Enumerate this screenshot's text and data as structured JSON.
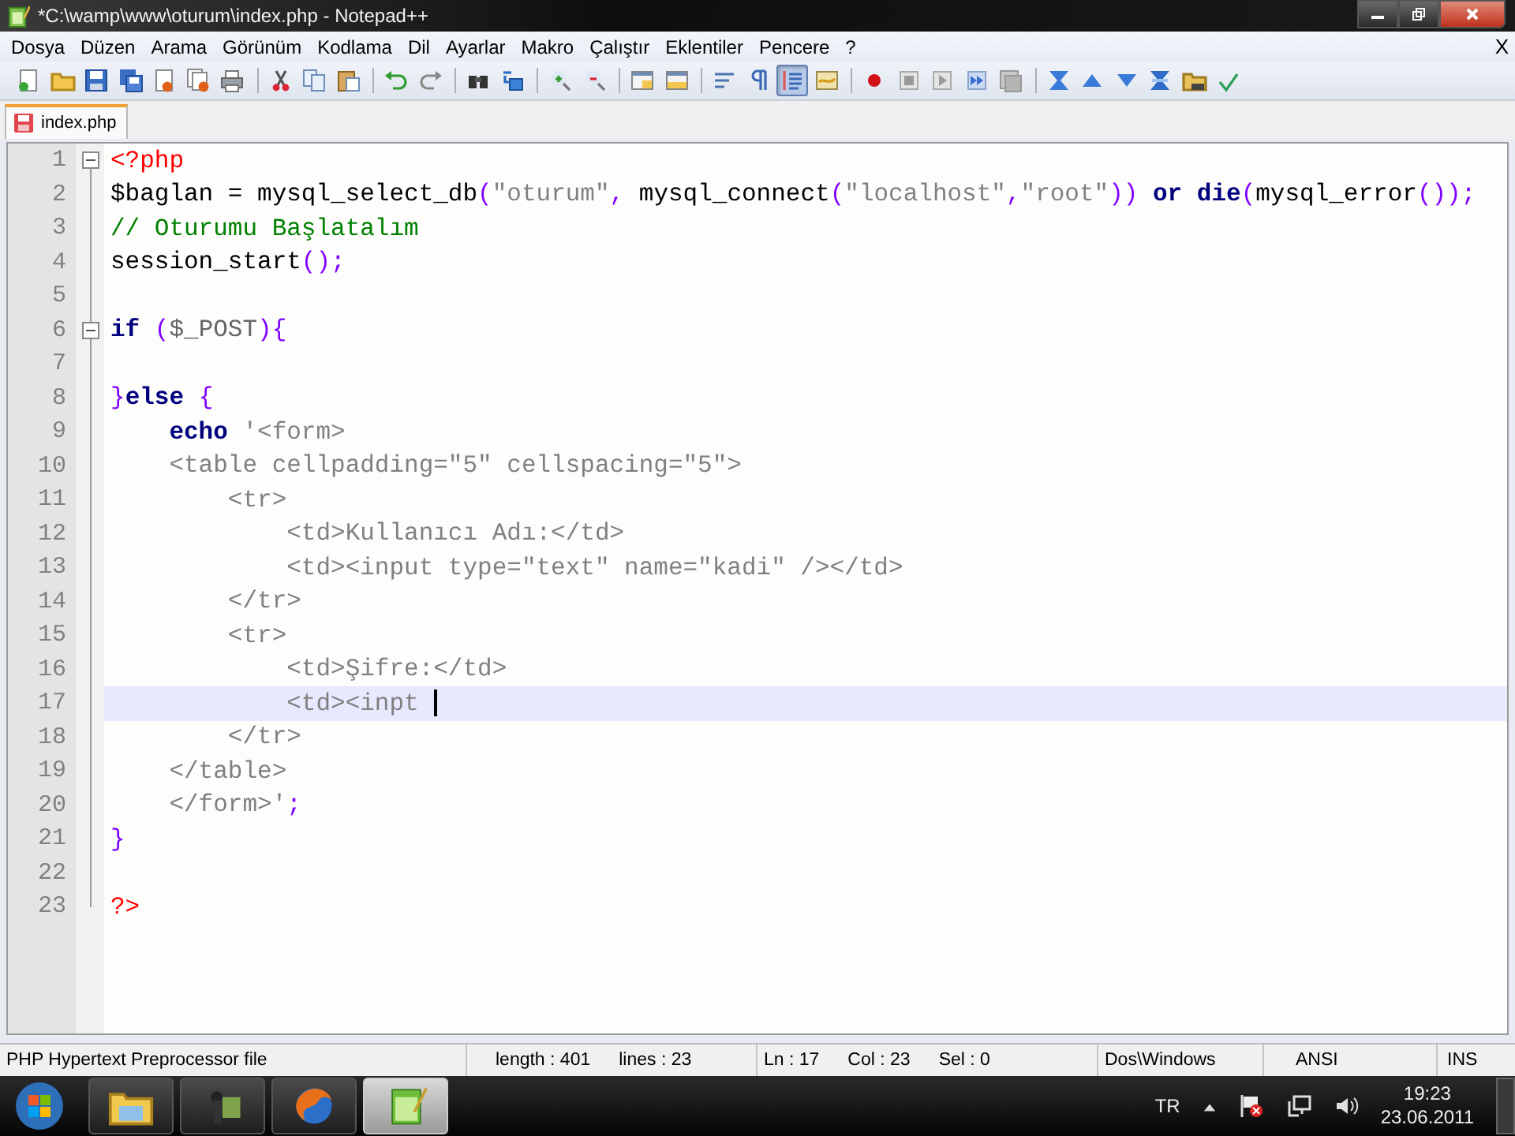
{
  "window": {
    "title": "*C:\\wamp\\www\\oturum\\index.php - Notepad++"
  },
  "menu": {
    "items": [
      "Dosya",
      "Düzen",
      "Arama",
      "Görünüm",
      "Kodlama",
      "Dil",
      "Ayarlar",
      "Makro",
      "Çalıştır",
      "Eklentiler",
      "Pencere",
      "?"
    ],
    "close_label": "X"
  },
  "toolbar": [
    {
      "kind": "new",
      "pressed": false
    },
    {
      "kind": "open",
      "pressed": false
    },
    {
      "kind": "save",
      "pressed": false
    },
    {
      "kind": "save-all",
      "pressed": false
    },
    {
      "kind": "close",
      "pressed": false
    },
    {
      "kind": "close-all",
      "pressed": false
    },
    {
      "kind": "print",
      "pressed": false
    },
    {
      "kind": "separator"
    },
    {
      "kind": "cut",
      "pressed": false
    },
    {
      "kind": "copy",
      "pressed": false
    },
    {
      "kind": "paste",
      "pressed": false
    },
    {
      "kind": "separator"
    },
    {
      "kind": "undo",
      "pressed": false
    },
    {
      "kind": "redo",
      "pressed": false
    },
    {
      "kind": "separator"
    },
    {
      "kind": "find",
      "pressed": false
    },
    {
      "kind": "replace",
      "pressed": false
    },
    {
      "kind": "separator"
    },
    {
      "kind": "zoom-in",
      "pressed": false
    },
    {
      "kind": "zoom-out",
      "pressed": false
    },
    {
      "kind": "separator"
    },
    {
      "kind": "sync-v",
      "pressed": false
    },
    {
      "kind": "sync-h",
      "pressed": false
    },
    {
      "kind": "separator"
    },
    {
      "kind": "wrap",
      "pressed": false
    },
    {
      "kind": "pilcrow",
      "pressed": false
    },
    {
      "kind": "indent",
      "pressed": true
    },
    {
      "kind": "panel",
      "pressed": false
    },
    {
      "kind": "separator"
    },
    {
      "kind": "record",
      "pressed": false
    },
    {
      "kind": "stop",
      "pressed": false
    },
    {
      "kind": "play",
      "pressed": false
    },
    {
      "kind": "play-multi",
      "pressed": false
    },
    {
      "kind": "macro-save",
      "pressed": false
    },
    {
      "kind": "separator"
    },
    {
      "kind": "collapse",
      "pressed": false
    },
    {
      "kind": "up",
      "pressed": false
    },
    {
      "kind": "down",
      "pressed": false
    },
    {
      "kind": "expand",
      "pressed": false
    },
    {
      "kind": "folder",
      "pressed": false
    },
    {
      "kind": "spell",
      "pressed": false
    }
  ],
  "tabs": [
    {
      "label": "index.php",
      "selected": true,
      "modified": true
    }
  ],
  "editor": {
    "lines": [
      {
        "number": "1",
        "collapsible": true,
        "current": false,
        "tokens": [
          {
            "kind": "phptag",
            "text": "<?php"
          }
        ]
      },
      {
        "number": "2",
        "collapsible": false,
        "current": false,
        "tokens": [
          {
            "kind": "plain",
            "text": "$baglan = mysql_select_db"
          },
          {
            "kind": "op",
            "text": "("
          },
          {
            "kind": "string",
            "text": "\"oturum\""
          },
          {
            "kind": "op",
            "text": ","
          },
          {
            "kind": "plain",
            "text": " mysql_connect"
          },
          {
            "kind": "op",
            "text": "("
          },
          {
            "kind": "string",
            "text": "\"localhost\""
          },
          {
            "kind": "op",
            "text": ","
          },
          {
            "kind": "string",
            "text": "\"root\""
          },
          {
            "kind": "op",
            "text": ")) "
          },
          {
            "kind": "keyword",
            "text": "or die"
          },
          {
            "kind": "op",
            "text": "("
          },
          {
            "kind": "plain",
            "text": "mysql_error"
          },
          {
            "kind": "op",
            "text": "());"
          }
        ]
      },
      {
        "number": "3",
        "collapsible": false,
        "current": false,
        "tokens": [
          {
            "kind": "comment",
            "text": "// Oturumu Başlatalım"
          }
        ]
      },
      {
        "number": "4",
        "collapsible": false,
        "current": false,
        "tokens": [
          {
            "kind": "plain",
            "text": "session_start"
          },
          {
            "kind": "op",
            "text": "();"
          }
        ]
      },
      {
        "number": "5",
        "collapsible": false,
        "current": false
      },
      {
        "number": "6",
        "collapsible": true,
        "current": false,
        "tokens": [
          {
            "kind": "keyword",
            "text": "if "
          },
          {
            "kind": "op",
            "text": "("
          },
          {
            "kind": "variable",
            "text": "$_POST"
          },
          {
            "kind": "op",
            "text": "){"
          }
        ]
      },
      {
        "number": "7",
        "collapsible": false,
        "current": false
      },
      {
        "number": "8",
        "collapsible": false,
        "current": false,
        "tokens": [
          {
            "kind": "op",
            "text": "}"
          },
          {
            "kind": "keyword",
            "text": "else "
          },
          {
            "kind": "op",
            "text": "{"
          }
        ]
      },
      {
        "number": "9",
        "collapsible": false,
        "current": false,
        "tokens": [
          {
            "kind": "keyword",
            "text": "    echo "
          },
          {
            "kind": "string",
            "text": "'<form>"
          }
        ]
      },
      {
        "number": "10",
        "collapsible": false,
        "current": false,
        "tokens": [
          {
            "kind": "string",
            "text": "    <table cellpadding=\"5\" cellspacing=\"5\">"
          }
        ]
      },
      {
        "number": "11",
        "collapsible": false,
        "current": false,
        "tokens": [
          {
            "kind": "string",
            "text": "        <tr>"
          }
        ]
      },
      {
        "number": "12",
        "collapsible": false,
        "current": false,
        "tokens": [
          {
            "kind": "string",
            "text": "            <td>Kullanıcı Adı:</td>"
          }
        ]
      },
      {
        "number": "13",
        "collapsible": false,
        "current": false,
        "tokens": [
          {
            "kind": "string",
            "text": "            <td><input type=\"text\" name=\"kadi\" /></td>"
          }
        ]
      },
      {
        "number": "14",
        "collapsible": false,
        "current": false,
        "tokens": [
          {
            "kind": "string",
            "text": "        </tr>"
          }
        ]
      },
      {
        "number": "15",
        "collapsible": false,
        "current": false,
        "tokens": [
          {
            "kind": "string",
            "text": "        <tr>"
          }
        ]
      },
      {
        "number": "16",
        "collapsible": false,
        "current": false,
        "tokens": [
          {
            "kind": "string",
            "text": "            <td>Şifre:</td>"
          }
        ]
      },
      {
        "number": "17",
        "collapsible": false,
        "current": true,
        "tokens": [
          {
            "kind": "string",
            "text": "            <td><inpt "
          }
        ]
      },
      {
        "number": "18",
        "collapsible": false,
        "current": false,
        "tokens": [
          {
            "kind": "string",
            "text": "        </tr>"
          }
        ]
      },
      {
        "number": "19",
        "collapsible": false,
        "current": false,
        "tokens": [
          {
            "kind": "string",
            "text": "    </table>"
          }
        ]
      },
      {
        "number": "20",
        "collapsible": false,
        "current": false,
        "tokens": [
          {
            "kind": "string",
            "text": "    </form>'"
          },
          {
            "kind": "op",
            "text": ";"
          }
        ]
      },
      {
        "number": "21",
        "collapsible": false,
        "current": false,
        "tokens": [
          {
            "kind": "op",
            "text": "}"
          }
        ]
      },
      {
        "number": "22",
        "collapsible": false,
        "current": false
      },
      {
        "number": "23",
        "collapsible": false,
        "current": false,
        "tokens": [
          {
            "kind": "phptag",
            "text": "?>"
          }
        ]
      }
    ]
  },
  "status_bar": {
    "file_type": "PHP Hypertext Preprocessor file",
    "length": "length : 401",
    "lines": "lines : 23",
    "line": "Ln : 17",
    "column": "Col : 23",
    "selection": "Sel : 0",
    "eol": "Dos\\Windows",
    "encoding": "ANSI",
    "mode": "INS"
  },
  "taskbar": {
    "apps": [
      {
        "kind": "explorer",
        "selected": false
      },
      {
        "kind": "media",
        "selected": false
      },
      {
        "kind": "browser",
        "selected": false
      },
      {
        "kind": "editor",
        "selected": true
      }
    ],
    "language": "TR",
    "time": "19:23",
    "date": "23.06.2011"
  }
}
